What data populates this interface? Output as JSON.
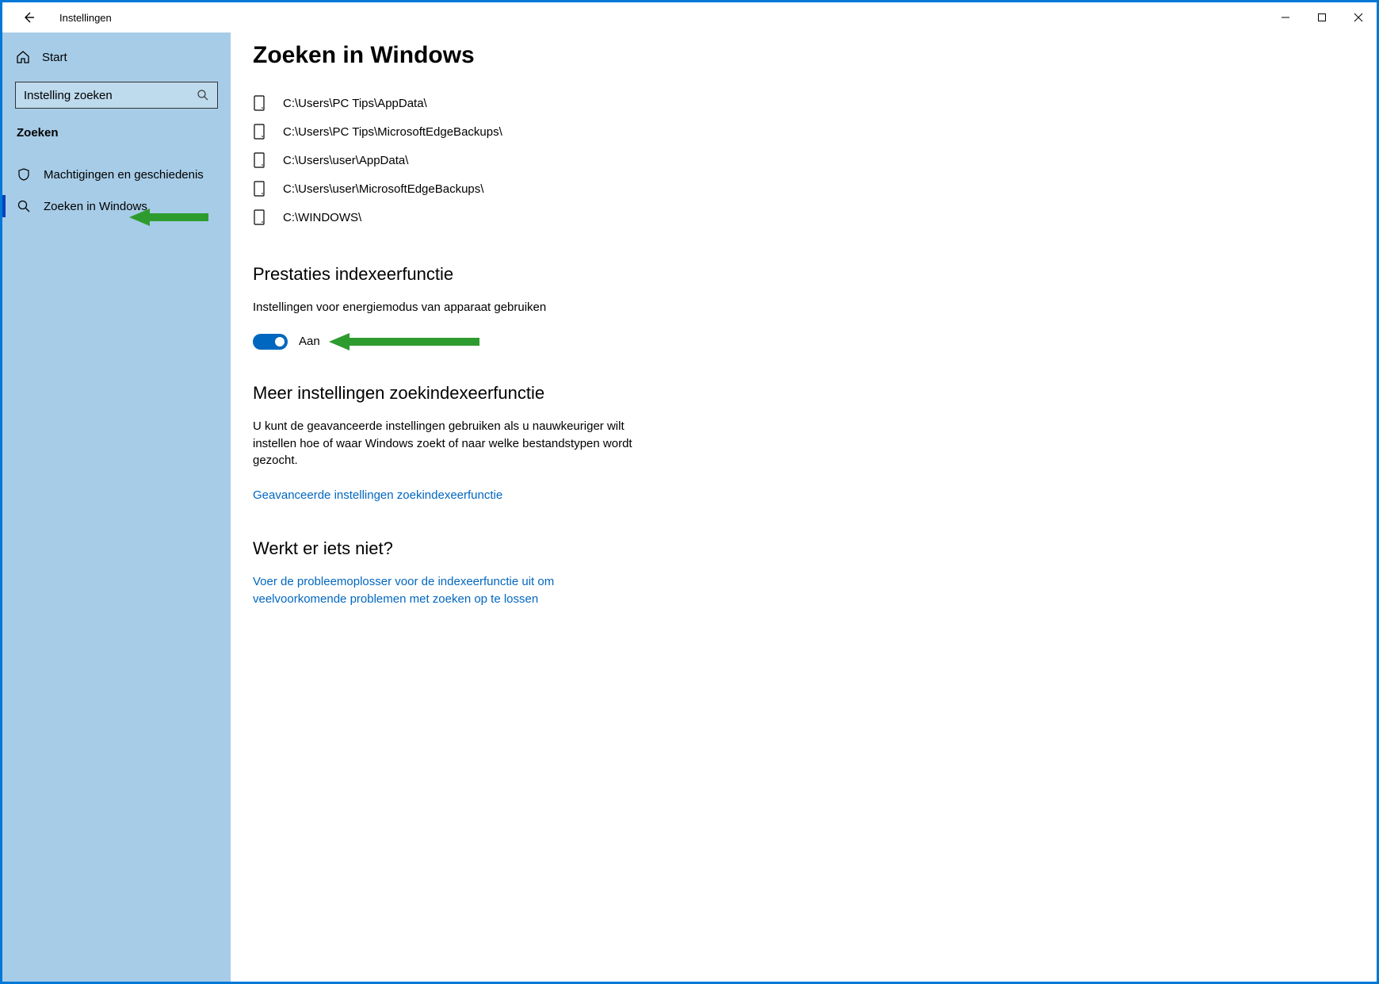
{
  "titlebar": {
    "title": "Instellingen"
  },
  "sidebar": {
    "home_label": "Start",
    "search_placeholder": "Instelling zoeken",
    "category": "Zoeken",
    "nav": [
      {
        "label": "Machtigingen en geschiedenis"
      },
      {
        "label": "Zoeken in Windows"
      }
    ]
  },
  "main": {
    "page_title": "Zoeken in Windows",
    "folders": [
      "C:\\Users\\PC Tips\\AppData\\",
      "C:\\Users\\PC Tips\\MicrosoftEdgeBackups\\",
      "C:\\Users\\user\\AppData\\",
      "C:\\Users\\user\\MicrosoftEdgeBackups\\",
      "C:\\WINDOWS\\"
    ],
    "perf_title": "Prestaties indexeerfunctie",
    "perf_desc": "Instellingen voor energiemodus van apparaat gebruiken",
    "toggle_label": "Aan",
    "more_title": "Meer instellingen zoekindexeerfunctie",
    "more_desc": "U kunt de geavanceerde instellingen gebruiken als u nauwkeuriger wilt instellen hoe of waar Windows zoekt of naar welke bestandstypen wordt gezocht.",
    "more_link": "Geavanceerde instellingen zoekindexeerfunctie",
    "trouble_title": "Werkt er iets niet?",
    "trouble_link": "Voer de probleemoplosser voor de indexeerfunctie uit om veelvoorkomende problemen met zoeken op te lossen"
  }
}
